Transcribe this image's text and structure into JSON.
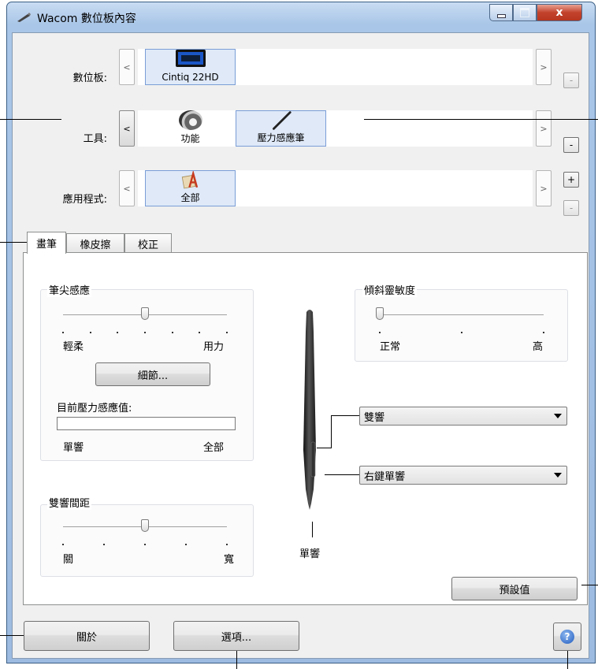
{
  "window": {
    "title": "Wacom 數位板內容",
    "close": "x"
  },
  "rows": {
    "tablet_label": "數位板:",
    "tool_label": "工具:",
    "app_label": "應用程式:",
    "tablet_items": [
      "Cintiq 22HD"
    ],
    "tool_items": [
      "功能",
      "壓力感應筆"
    ],
    "app_items": [
      "全部"
    ],
    "prev": "<",
    "next": ">",
    "add": "+",
    "remove": "-"
  },
  "tabs": [
    "畫筆",
    "橡皮擦",
    "校正"
  ],
  "tip_feel": {
    "title": "筆尖感應",
    "left": "輕柔",
    "right": "用力",
    "level": 0.5,
    "details_button": "細節...",
    "current_pressure_label": "目前壓力感應值:",
    "bar_left": "單響",
    "bar_right": "全部"
  },
  "tilt": {
    "title": "傾斜靈敏度",
    "left": "正常",
    "right": "高",
    "level": 0.0
  },
  "double_click": {
    "title": "雙響間距",
    "left": "關",
    "right": "寬",
    "level": 0.5
  },
  "pen_buttons": {
    "upper": "雙響",
    "lower": "右鍵單響",
    "tip": "單響"
  },
  "buttons": {
    "default": "預設值",
    "about": "關於",
    "options": "選項..."
  }
}
